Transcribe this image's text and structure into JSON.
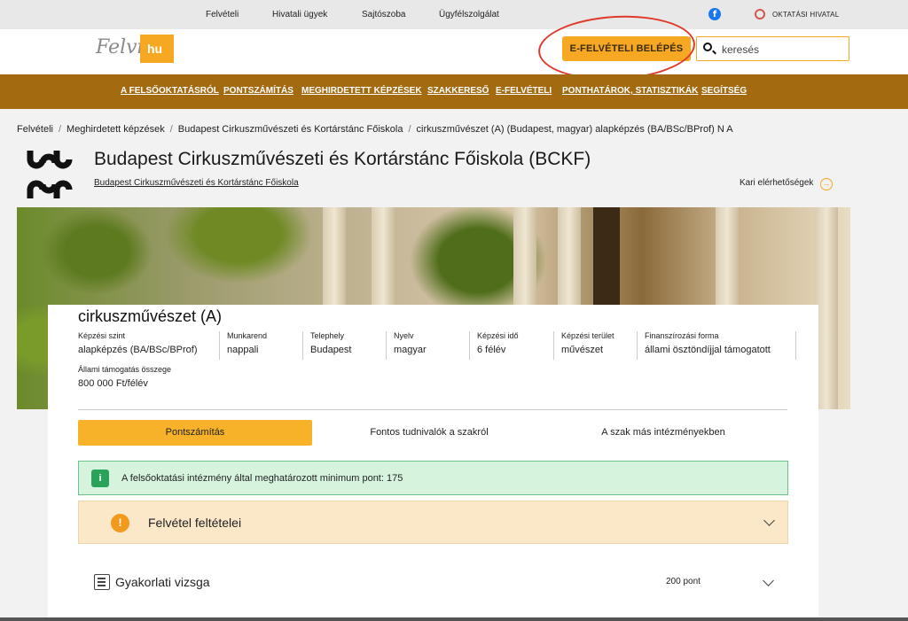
{
  "topbar": {
    "links": [
      "Felvételi",
      "Hivatali ügyek",
      "Sajtószoba",
      "Ügyfélszolgálat"
    ],
    "facebook_icon": "facebook-icon",
    "oh_label": "OKTATÁSI HIVATAL"
  },
  "header": {
    "logo_text": "Felvi",
    "logo_badge": "hu",
    "login_button": "E-FELVÉTELI BELÉPÉS",
    "search_value": "keresés"
  },
  "nav": {
    "items": [
      "A FELSŐOKTATÁSRÓL",
      "PONTSZÁMÍTÁS",
      "MEGHIRDETETT KÉPZÉSEK",
      "SZAKKERESŐ",
      "E-FELVÉTELI",
      "PONTHATÁROK, STATISZTIKÁK",
      "SEGÍTSÉG"
    ]
  },
  "breadcrumb": [
    "Felvételi",
    "Meghirdetett képzések",
    "Budapest Cirkuszművészeti és Kortárstánc Főiskola",
    "cirkuszművészet (A) (Budapest, magyar) alapképzés (BA/BSc/BProf) N A"
  ],
  "institution": {
    "title": "Budapest Cirkuszművészeti és Kortárstánc Főiskola (BCKF)",
    "subtitle": "Budapest Cirkuszművészeti és Kortárstánc Főiskola",
    "contact_link": "Kari elérhetőségek"
  },
  "program": {
    "title": "cirkuszművészet (A)",
    "details": [
      {
        "label": "Képzési szint",
        "value": "alapképzés (BA/BSc/BProf)"
      },
      {
        "label": "Munkarend",
        "value": "nappali"
      },
      {
        "label": "Telephely",
        "value": "Budapest"
      },
      {
        "label": "Nyelv",
        "value": "magyar"
      },
      {
        "label": "Képzési idő",
        "value": "6 félév"
      },
      {
        "label": "Képzési terület",
        "value": "művészet"
      },
      {
        "label": "Finanszírozási forma",
        "value": "állami ösztöndíjjal támogatott"
      }
    ],
    "support": {
      "label": "Állami támogatás összege",
      "value": "800 000 Ft/félév"
    }
  },
  "tabs": [
    "Pontszámítás",
    "Fontos tudnivalók a szakról",
    "A szak más intézményekben"
  ],
  "alert": {
    "icon": "i",
    "text": "A felsőoktatási intézmény által meghatározott minimum pont: 175"
  },
  "conditions": {
    "icon": "!",
    "title": "Felvétel feltételei"
  },
  "exam": {
    "title": "Gyakorlati vizsga",
    "points": "200 pont"
  },
  "colors": {
    "accent": "#f7a823",
    "nav": "#a46a0f",
    "success": "#2aa25a"
  }
}
